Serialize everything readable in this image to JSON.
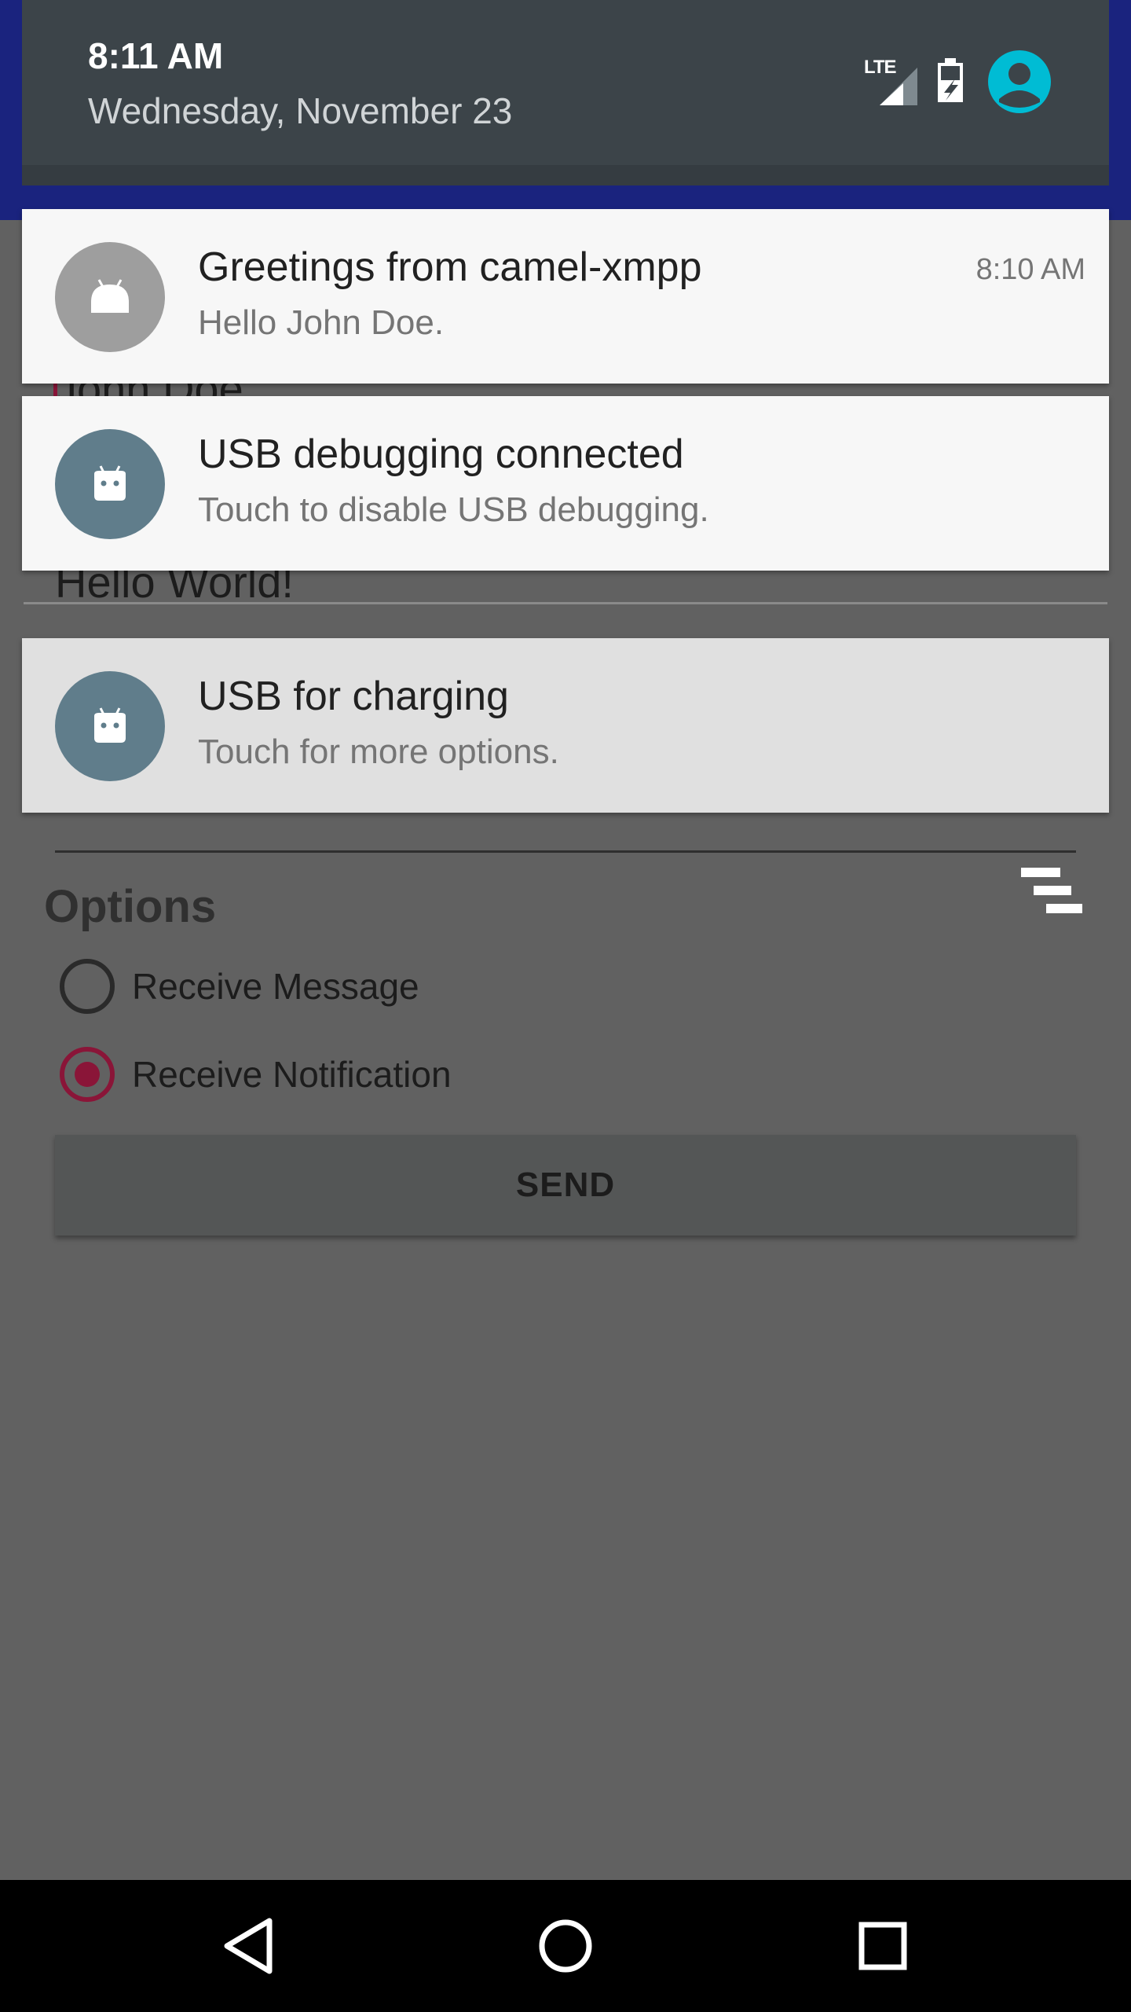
{
  "status": {
    "time": "8:11 AM",
    "date": "Wednesday, November 23",
    "network_label": "LTE",
    "icons": [
      "lte-signal-icon",
      "battery-icon",
      "user-account-icon"
    ],
    "accent_color": "#00bcd4"
  },
  "notifications": [
    {
      "title": "Greetings from camel-xmpp",
      "text": "Hello John Doe.",
      "time": "8:10 AM",
      "icon": "android-icon",
      "icon_color": "#9e9e9e"
    },
    {
      "title": "USB debugging connected",
      "text": "Touch to disable USB debugging.",
      "icon": "android-icon",
      "icon_color": "#607d8b"
    },
    {
      "title": "USB for charging",
      "text": "Touch for more options.",
      "icon": "android-icon",
      "icon_color": "#607d8b"
    }
  ],
  "app": {
    "name_field": "John Doe",
    "message_field": "Hello World!",
    "options_label": "Options",
    "radio_options": [
      {
        "label": "Receive Message",
        "checked": false
      },
      {
        "label": "Receive Notification",
        "checked": true
      }
    ],
    "send_label": "SEND",
    "accent_color": "#8a1538"
  },
  "navbar": {
    "icons": [
      "back-icon",
      "home-icon",
      "recents-icon"
    ]
  }
}
